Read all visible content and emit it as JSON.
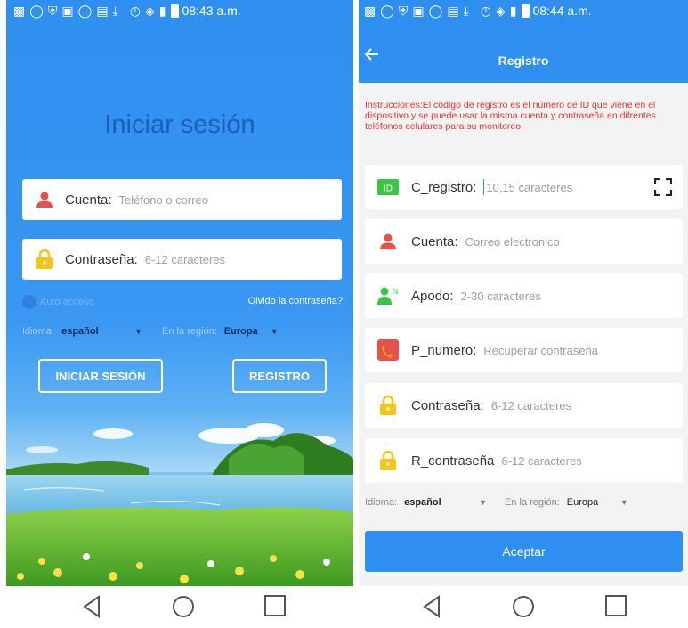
{
  "left": {
    "status": {
      "time": "08:43 a.m."
    },
    "title": "Iniciar sesión",
    "account": {
      "label": "Cuenta:",
      "placeholder": "Teléfono o correo"
    },
    "password": {
      "label": "Contraseña:",
      "placeholder": "6-12 caracteres"
    },
    "auto_login": "Auto acceso",
    "forgot": "Olvido la contraseña?",
    "language": {
      "label": "Idioma:",
      "value": "español"
    },
    "region": {
      "label": "En la región:",
      "value": "Europa"
    },
    "login_button": "INICIAR SESIÓN",
    "register_button": "REGISTRO"
  },
  "right": {
    "status": {
      "time": "08:44 a.m."
    },
    "title": "Registro",
    "instructions": "Instrucciones:El código de registro es el número de ID que viene en el dispositivo y se puede usar la misma cuenta y contraseña en difrentes teléfonos celulares para su monitoreo.",
    "fields": [
      {
        "label": "C_registro:",
        "placeholder": "10,15 caracteres",
        "icon": "id-icon"
      },
      {
        "label": "Cuenta:",
        "placeholder": "Correo electronico",
        "icon": "user-icon"
      },
      {
        "label": "Apodo:",
        "placeholder": "2-30 caracteres",
        "icon": "nickname-icon"
      },
      {
        "label": "P_numero:",
        "placeholder": "Recuperar contraseña",
        "icon": "phone-icon"
      },
      {
        "label": "Contraseña:",
        "placeholder": "6-12 caracteres",
        "icon": "lock-icon"
      },
      {
        "label": "R_contraseña",
        "placeholder": "6-12 caracteres",
        "icon": "lock-icon"
      }
    ],
    "language": {
      "label": "Idioma:",
      "value": "español"
    },
    "region": {
      "label": "En la región:",
      "value": "Europa"
    },
    "accept_button": "Aceptar"
  },
  "colors": {
    "primary": "#2f8ff0",
    "title_dark_blue": "#1c5fb8",
    "instruction_red": "#e8322c",
    "user_red": "#e8504a",
    "lock_yellow": "#f5c518",
    "id_green": "#3cc44a"
  }
}
